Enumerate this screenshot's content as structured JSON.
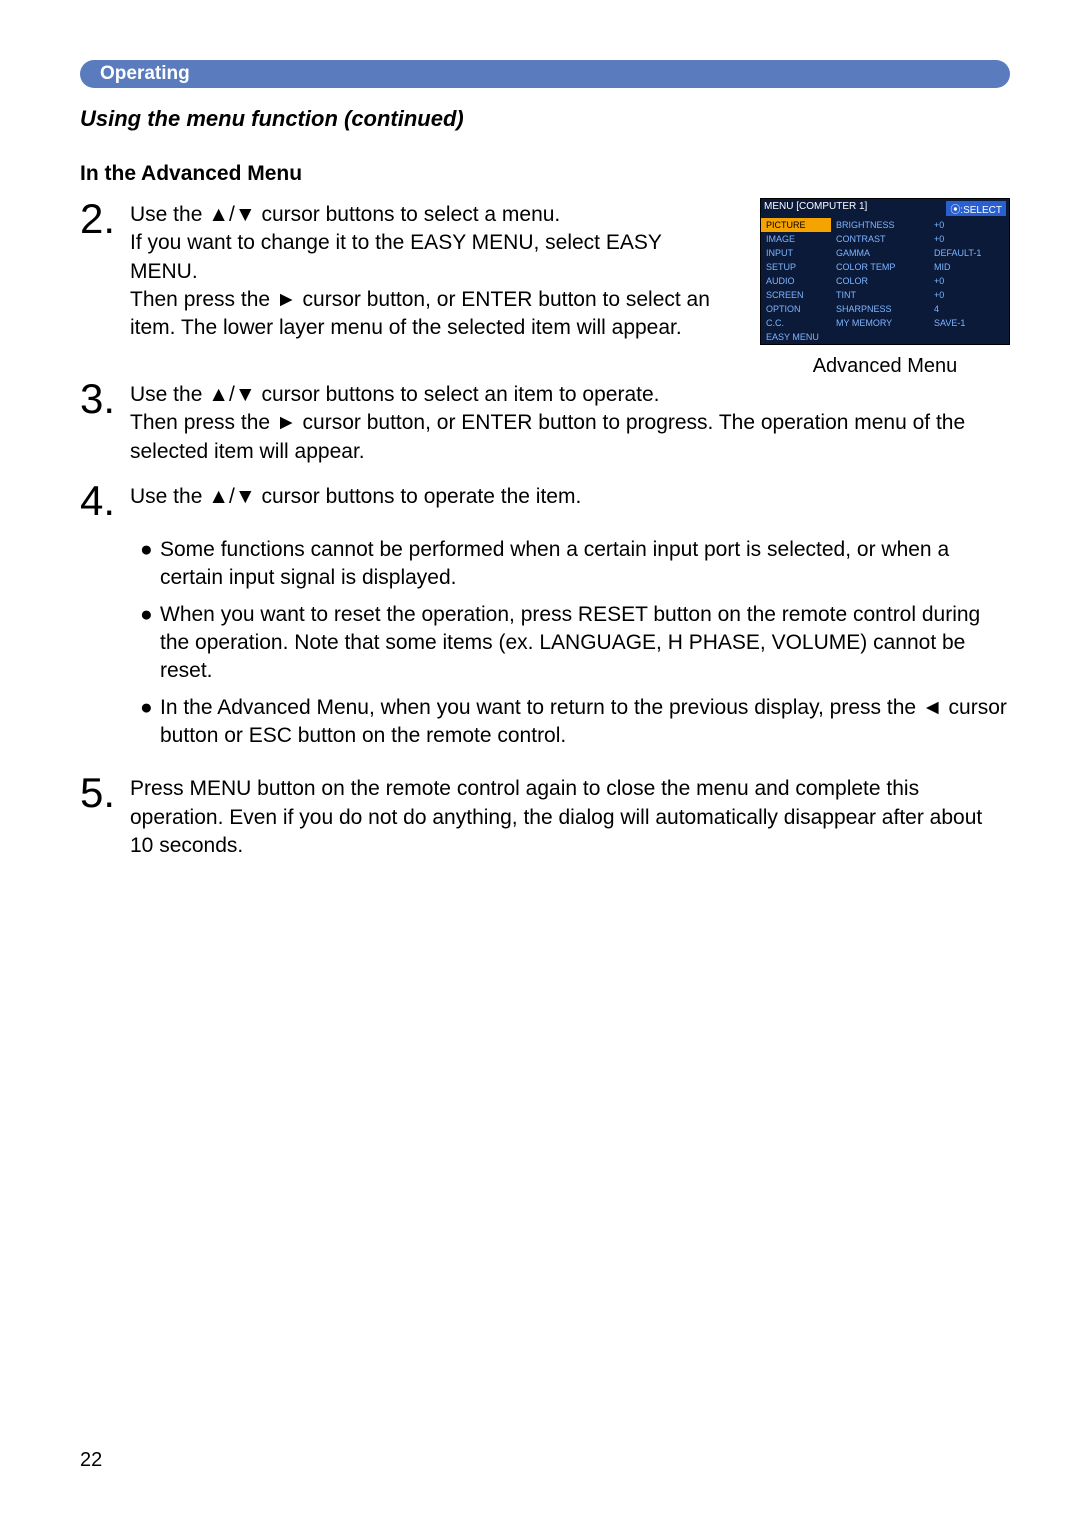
{
  "section_label": "Operating",
  "title": "Using the menu function (continued)",
  "subheading": "In the Advanced Menu",
  "steps": {
    "2": "Use the ▲/▼ cursor buttons to select a menu.\nIf you want to change it to the EASY MENU, select EASY MENU.\nThen press the ► cursor button, or ENTER button to select an item. The lower layer menu of the selected item will appear.",
    "3": "Use the ▲/▼ cursor buttons to select an item to operate.\nThen press the ► cursor button, or ENTER button to progress. The operation menu of the selected item will appear.",
    "4": "Use the ▲/▼ cursor buttons to operate the item.",
    "5": "Press MENU button on the remote control again to close the menu and complete this operation. Even if you do not do anything, the dialog will automatically disappear after about 10 seconds."
  },
  "bullets": [
    "Some functions cannot be performed when a certain input port is selected, or when a certain input signal is displayed.",
    "When you want to reset the operation, press RESET button on the remote control during the operation. Note that some items (ex. LANGUAGE, H PHASE, VOLUME) cannot be reset.",
    "In the Advanced Menu, when you want to return to the previous display, press the ◄ cursor button or ESC button on the remote control."
  ],
  "menu_figure": {
    "header_left": "MENU [COMPUTER 1]",
    "header_right": "⦿:SELECT",
    "left_items": [
      "PICTURE",
      "IMAGE",
      "INPUT",
      "SETUP",
      "AUDIO",
      "SCREEN",
      "OPTION",
      "C.C.",
      "EASY MENU"
    ],
    "mid_items": [
      "BRIGHTNESS",
      "CONTRAST",
      "GAMMA",
      "COLOR TEMP",
      "COLOR",
      "TINT",
      "SHARPNESS",
      "MY MEMORY"
    ],
    "right_items": [
      "+0",
      "+0",
      "DEFAULT-1",
      "MID",
      "+0",
      "+0",
      "4",
      "SAVE-1"
    ],
    "caption": "Advanced Menu"
  },
  "page_number": "22"
}
